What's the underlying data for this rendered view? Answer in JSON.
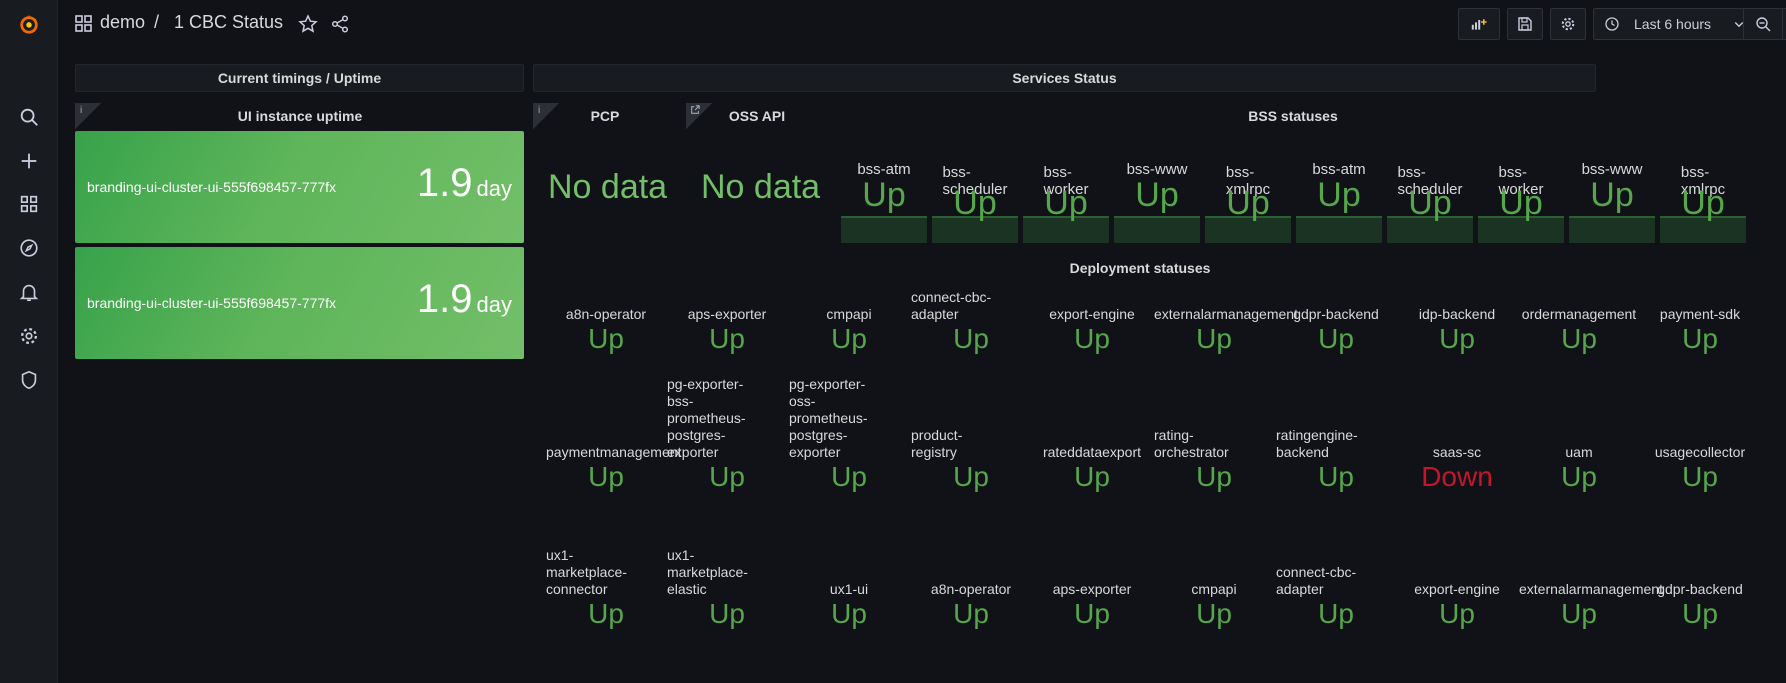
{
  "breadcrumb": {
    "folder": "demo",
    "separator": "/",
    "dashboard": "1 CBC Status"
  },
  "toolbar": {
    "time_range": "Last 6 hours"
  },
  "rows": {
    "timings": "Current timings / Uptime",
    "services": "Services Status"
  },
  "uptime_panel": {
    "title": "UI instance uptime",
    "info": "i",
    "items": [
      {
        "name": "branding-ui-cluster-ui-555f698457-777fx",
        "value": "1.9",
        "unit": "day"
      },
      {
        "name": "branding-ui-cluster-ui-555f698457-777fx",
        "value": "1.9",
        "unit": "day"
      }
    ]
  },
  "pcp_panel": {
    "title": "PCP",
    "info": "i",
    "value": "No data"
  },
  "oss_panel": {
    "title": "OSS API",
    "value": "No data"
  },
  "bss_panel": {
    "title": "BSS statuses",
    "items": [
      {
        "label": "bss-atm",
        "value": "Up"
      },
      {
        "label": "bss-\nscheduler",
        "value": "Up"
      },
      {
        "label": "bss-\nworker",
        "value": "Up"
      },
      {
        "label": "bss-www",
        "value": "Up"
      },
      {
        "label": "bss-\nxmlrpc",
        "value": "Up"
      },
      {
        "label": "bss-atm",
        "value": "Up"
      },
      {
        "label": "bss-\nscheduler",
        "value": "Up"
      },
      {
        "label": "bss-\nworker",
        "value": "Up"
      },
      {
        "label": "bss-www",
        "value": "Up"
      },
      {
        "label": "bss-\nxmlrpc",
        "value": "Up"
      }
    ]
  },
  "deployment_panel": {
    "title": "Deployment statuses",
    "items": [
      {
        "label": "a8n-operator",
        "value": "Up"
      },
      {
        "label": "aps-exporter",
        "value": "Up"
      },
      {
        "label": "cmpapi",
        "value": "Up"
      },
      {
        "label": "connect-cbc-\nadapter",
        "value": "Up"
      },
      {
        "label": "export-engine",
        "value": "Up"
      },
      {
        "label": "externalarmanagement",
        "value": "Up"
      },
      {
        "label": "gdpr-backend",
        "value": "Up"
      },
      {
        "label": "idp-backend",
        "value": "Up"
      },
      {
        "label": "ordermanagement",
        "value": "Up"
      },
      {
        "label": "payment-sdk",
        "value": "Up"
      },
      {
        "label": "paymentmanagement",
        "value": "Up"
      },
      {
        "label": "pg-exporter-\nbss-\nprometheus-\npostgres-\nexporter",
        "value": "Up"
      },
      {
        "label": "pg-exporter-\noss-\nprometheus-\npostgres-\nexporter",
        "value": "Up"
      },
      {
        "label": "product-\nregistry",
        "value": "Up"
      },
      {
        "label": "rateddataexport",
        "value": "Up"
      },
      {
        "label": "rating-\norchestrator",
        "value": "Up"
      },
      {
        "label": "ratingengine-\nbackend",
        "value": "Up"
      },
      {
        "label": "saas-sc",
        "value": "Down"
      },
      {
        "label": "uam",
        "value": "Up"
      },
      {
        "label": "usagecollector",
        "value": "Up"
      },
      {
        "label": "ux1-\nmarketplace-\nconnector",
        "value": "Up"
      },
      {
        "label": "ux1-\nmarketplace-\nelastic",
        "value": "Up"
      },
      {
        "label": "ux1-ui",
        "value": "Up"
      },
      {
        "label": "a8n-operator",
        "value": "Up"
      },
      {
        "label": "aps-exporter",
        "value": "Up"
      },
      {
        "label": "cmpapi",
        "value": "Up"
      },
      {
        "label": "connect-cbc-\nadapter",
        "value": "Up"
      },
      {
        "label": "export-engine",
        "value": "Up"
      },
      {
        "label": "externalarmanagement",
        "value": "Up"
      },
      {
        "label": "gdpr-backend",
        "value": "Up"
      }
    ]
  },
  "colors": {
    "up": "#56a64b",
    "down": "#c4162a",
    "accent": "#f05a28"
  }
}
